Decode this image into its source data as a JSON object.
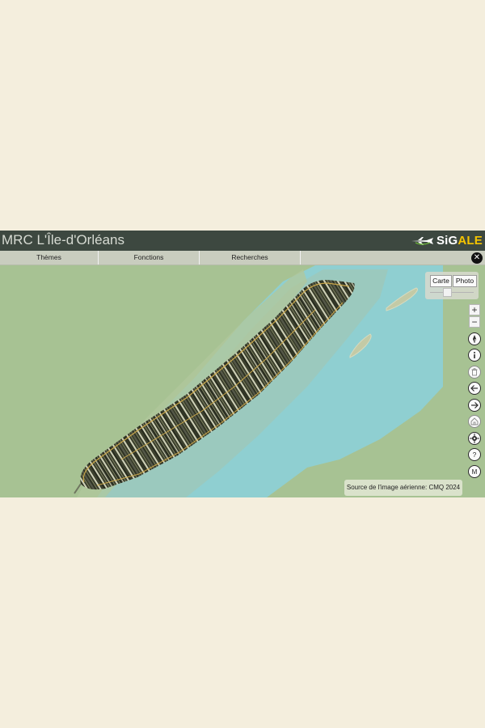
{
  "app": {
    "title": "MRC L'Île-d'Orléans",
    "logo": {
      "prefix": "SiG",
      "suffix": "ALE"
    }
  },
  "menu": {
    "items": [
      {
        "label": "Thèmes"
      },
      {
        "label": "Fonctions"
      },
      {
        "label": "Recherches"
      }
    ]
  },
  "basemap": {
    "carte_label": "Carte",
    "photo_label": "Photo",
    "selected": "Photo"
  },
  "toolbar": {
    "zoom_in": "+",
    "zoom_out": "−",
    "tools": [
      {
        "name": "compass-icon"
      },
      {
        "name": "info-icon"
      },
      {
        "name": "trash-icon"
      },
      {
        "name": "back-arrow-icon"
      },
      {
        "name": "forward-arrow-icon"
      },
      {
        "name": "home-icon"
      },
      {
        "name": "crosshair-icon"
      },
      {
        "name": "help-icon",
        "glyph": "?"
      },
      {
        "name": "measure-icon",
        "glyph": "M"
      }
    ]
  },
  "attribution": "Source de l'image aérienne: CMQ 2024",
  "colors": {
    "titlebar": "#3d4840",
    "menubar": "#c9cdbf",
    "land": "#a7c293",
    "water": "#8fcfd1",
    "island": "#2f3424",
    "road": "#c9a64a"
  }
}
